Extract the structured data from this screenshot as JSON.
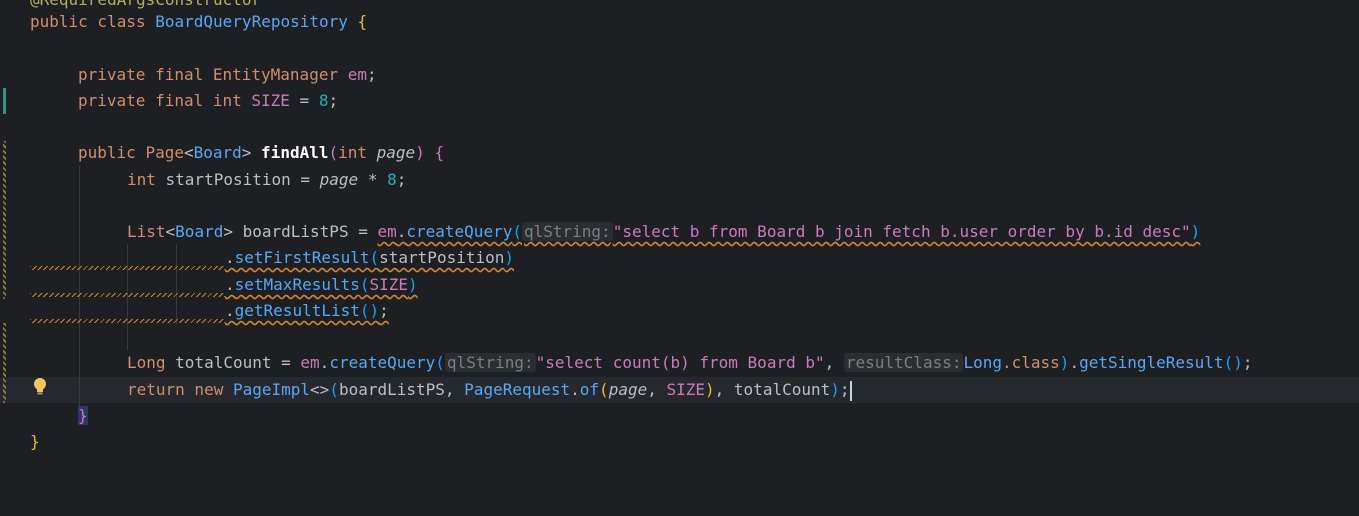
{
  "editor": {
    "lines": {
      "l0": "@RequiredArgsConstructor",
      "l1_kw": "public class ",
      "l1_name": "BoardQueryRepository",
      "l1_brace": " {",
      "l2_kw": "private final ",
      "l2_type": "EntityManager",
      "l2_name": " em",
      "l2_semi": ";",
      "l3_kw": "private final int ",
      "l3_name": "SIZE",
      "l3_eq": " = ",
      "l3_num": "8",
      "l3_semi": ";",
      "l4_kw": "public ",
      "l4_type": "Page",
      "l4_lt": "<",
      "l4_tp": "Board",
      "l4_gt": "> ",
      "l4_meth": "findAll",
      "l4_open": "(",
      "l4_int": "int ",
      "l4_param": "page",
      "l4_close": ")",
      "l4_brace": " {",
      "l5_kw": "int ",
      "l5_var": "startPosition = ",
      "l5_param": "page",
      "l5_op": " * ",
      "l5_num": "8",
      "l5_semi": ";",
      "l6_type": "List",
      "l6_lt": "<",
      "l6_tp": "Board",
      "l6_gt": "> ",
      "l6_var": "boardListPS = ",
      "l6_em": "em",
      "l6_dot": ".",
      "l6_meth": "createQuery",
      "l6_open": "(",
      "l6_hint": "qlString:",
      "l6_str": "\"select b from Board b join fetch b.user order by b.id desc\"",
      "l6_close": ")",
      "l7_dot": ".",
      "l7_meth": "setFirstResult",
      "l7_open": "(",
      "l7_arg": "startPosition",
      "l7_close": ")",
      "l8_dot": ".",
      "l8_meth": "setMaxResults",
      "l8_open": "(",
      "l8_arg": "SIZE",
      "l8_close": ")",
      "l9_dot": ".",
      "l9_meth": "getResultList",
      "l9_parens": "()",
      "l9_semi": ";",
      "l10_type": "Long ",
      "l10_var": "totalCount = ",
      "l10_em": "em",
      "l10_dot": ".",
      "l10_meth": "createQuery",
      "l10_open": "(",
      "l10_hint1": "qlString:",
      "l10_str": "\"select count(b) from Board b\"",
      "l10_comma": ", ",
      "l10_hint2": "resultClass:",
      "l10_cls": "Long",
      "l10_dotclass": ".class",
      "l10_close": ")",
      "l10_dot2": ".",
      "l10_meth2": "getSingleResult",
      "l10_parens": "()",
      "l10_semi": ";",
      "l11_kw": "return new ",
      "l11_type": "PageImpl",
      "l11_diamond": "<>",
      "l11_open": "(",
      "l11_a1": "boardListPS, ",
      "l11_type2": "PageRequest",
      "l11_dot": ".",
      "l11_meth": "of",
      "l11_open2": "(",
      "l11_param": "page",
      "l11_comma": ", ",
      "l11_size": "SIZE",
      "l11_close2": ")",
      "l11_a3": ", totalCount",
      "l11_close": ")",
      "l11_semi": ";",
      "l12": "}",
      "l13": "}"
    },
    "colors": {
      "background": "#1e1f22",
      "keyword": "#cf8e6d",
      "field": "#c77dbb",
      "method": "#56a8f5",
      "number": "#2aacb8"
    },
    "icons": {
      "intention": "lightbulb-icon"
    }
  }
}
